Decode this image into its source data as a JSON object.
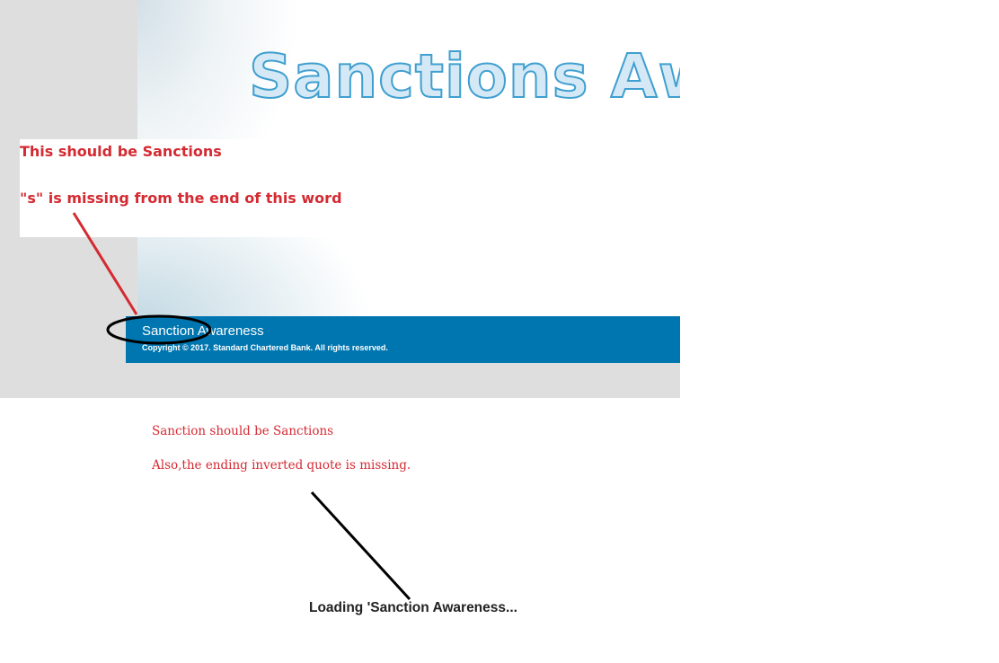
{
  "course": {
    "banner_title": "Sanctions Awareness",
    "footer_title": "Sanction Awareness",
    "copyright": "Copyright © 2017. Standard Chartered Bank. All rights reserved."
  },
  "annotations": {
    "note_1": "This should be Sanctions",
    "note_2": "\"s\" is missing from the end of this word",
    "comment_1": "Sanction should be Sanctions",
    "comment_2": "Also,the ending inverted quote is missing."
  },
  "loading": {
    "text": "Loading 'Sanction Awareness..."
  },
  "colors": {
    "annotation_red": "#d42a32",
    "footer_blue": "#0076b0",
    "title_stroke": "#3f9fd0"
  }
}
